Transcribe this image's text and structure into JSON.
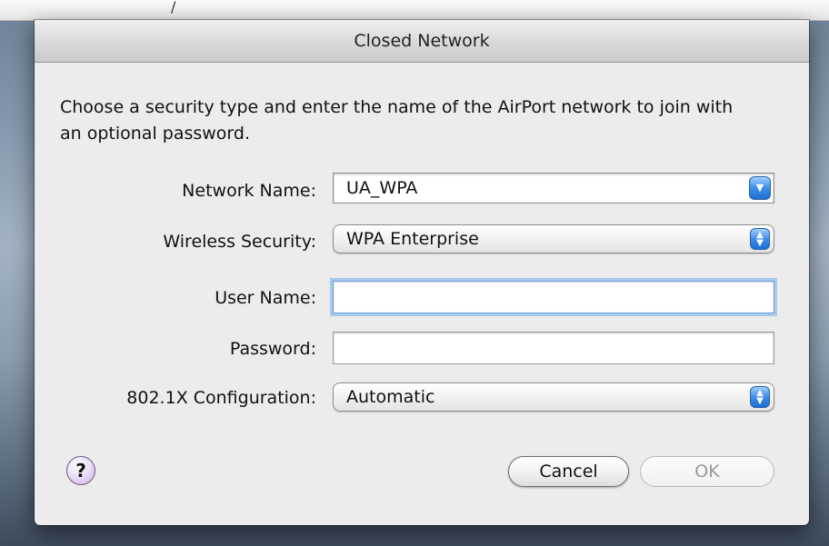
{
  "desktop": {
    "menu_glyph": "/"
  },
  "dialog": {
    "title": "Closed Network",
    "instructions": "Choose a security type and enter the name of the AirPort network to join with an optional password."
  },
  "fields": {
    "network_name": {
      "label": "Network Name:",
      "value": "UA_WPA"
    },
    "wireless_security": {
      "label": "Wireless Security:",
      "value": "WPA Enterprise"
    },
    "user_name": {
      "label": "User Name:",
      "value": ""
    },
    "password": {
      "label": "Password:",
      "value": ""
    },
    "config": {
      "label": "802.1X Configuration:",
      "value": "Automatic"
    }
  },
  "buttons": {
    "help": "?",
    "cancel": "Cancel",
    "ok": "OK"
  },
  "icons": {
    "help": "question-mark-icon",
    "combo_arrow": "chevron-down-icon",
    "popup_stepper": "up-down-arrows-icon"
  },
  "colors": {
    "accent": "#3d8ee8",
    "focus_ring": "#a9c9ee",
    "sheet_bg": "#ececec"
  }
}
